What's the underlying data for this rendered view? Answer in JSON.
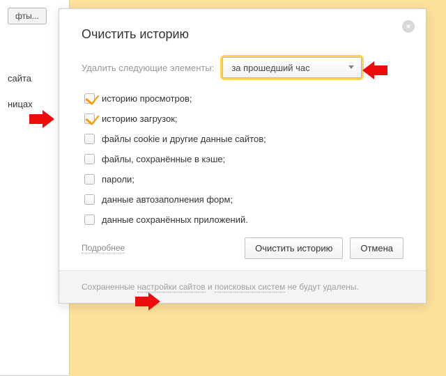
{
  "background": {
    "button_label": "фты...",
    "text1": "сайта",
    "text2": "ницах"
  },
  "dialog": {
    "title": "Очистить историю",
    "period_label": "Удалить следующие элементы:",
    "select_value": "за прошедший час",
    "options": [
      {
        "label": "историю просмотров;",
        "checked": true
      },
      {
        "label": "историю загрузок;",
        "checked": true
      },
      {
        "label": "файлы cookie и другие данные сайтов;",
        "checked": false
      },
      {
        "label": "файлы, сохранённые в кэше;",
        "checked": false
      },
      {
        "label": "пароли;",
        "checked": false
      },
      {
        "label": "данные автозаполнения форм;",
        "checked": false
      },
      {
        "label": "данные сохранённых приложений.",
        "checked": false
      }
    ],
    "more_link": "Подробнее",
    "clear_button": "Очистить историю",
    "cancel_button": "Отмена",
    "footer_prefix": "Сохраненные ",
    "footer_link1": "настройки сайтов",
    "footer_mid": " и ",
    "footer_link2": "поисковых систем",
    "footer_suffix": " не будут удалены."
  }
}
